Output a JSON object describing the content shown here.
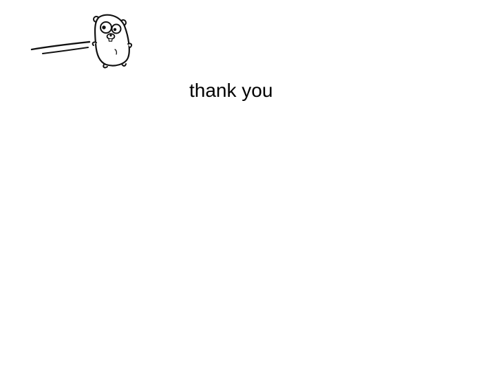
{
  "slide": {
    "text": "thank you",
    "illustration": "gopher-mascot-icon",
    "colors": {
      "background": "#ffffff",
      "text": "#000000",
      "ink": "#111111"
    }
  }
}
